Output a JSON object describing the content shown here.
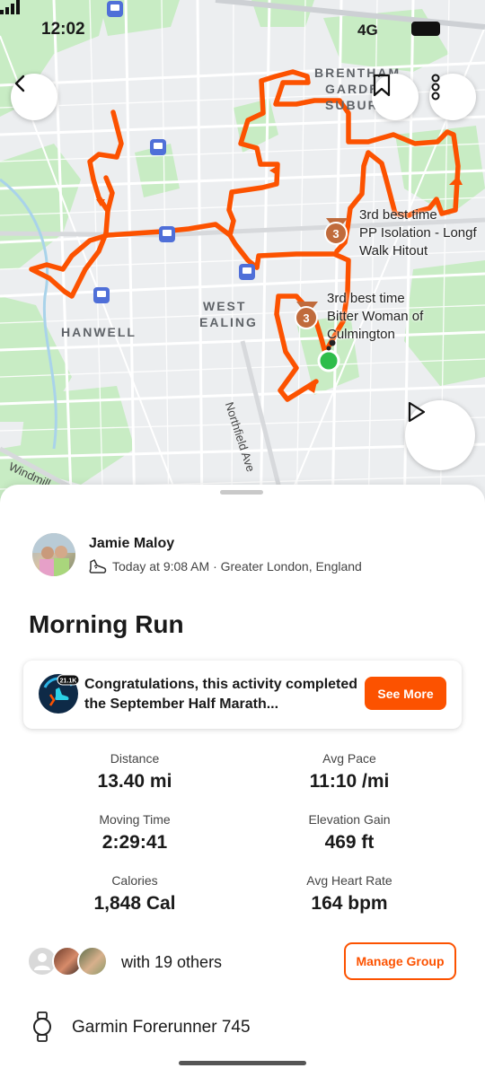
{
  "status_bar": {
    "time": "12:02",
    "network": "4G"
  },
  "map": {
    "labels": {
      "brentham": [
        "BRENTHAM",
        "GARDEN",
        "SUBURB"
      ],
      "west_ealing": [
        "WEST",
        "EALING"
      ],
      "hanwell": "HANWELL",
      "northfield_ave": "Northfield Ave",
      "windmill": "Windmill"
    },
    "segments": [
      {
        "rank": "3",
        "line1": "3rd best time",
        "line2": "PP Isolation - Longf",
        "line3": "Walk Hitout"
      },
      {
        "rank": "3",
        "line1": "3rd best time",
        "line2": "Bitter Woman of",
        "line3": "Culmington"
      }
    ],
    "route_color": "#fc5200",
    "start_color": "#2ebd4a"
  },
  "icons": {
    "back": "chevron-left-icon",
    "bookmark": "bookmark-icon",
    "more": "more-vertical-icon",
    "play": "play-icon",
    "shoe": "shoe-icon",
    "watch": "watch-icon"
  },
  "activity": {
    "athlete": "Jamie Maloy",
    "meta": "Today at 9:08 AM · Greater London, England",
    "title": "Morning Run",
    "challenge": {
      "badge_text": "21.1K",
      "message": "Congratulations, this activity completed the September Half Marath...",
      "button": "See More"
    },
    "stats": [
      {
        "label": "Distance",
        "value": "13.40 mi"
      },
      {
        "label": "Avg Pace",
        "value": "11:10 /mi"
      },
      {
        "label": "Moving Time",
        "value": "2:29:41"
      },
      {
        "label": "Elevation Gain",
        "value": "469 ft"
      },
      {
        "label": "Calories",
        "value": "1,848 Cal"
      },
      {
        "label": "Avg Heart Rate",
        "value": "164 bpm"
      }
    ],
    "group": {
      "text": "with 19 others",
      "button": "Manage Group"
    },
    "device": "Garmin Forerunner 745"
  }
}
